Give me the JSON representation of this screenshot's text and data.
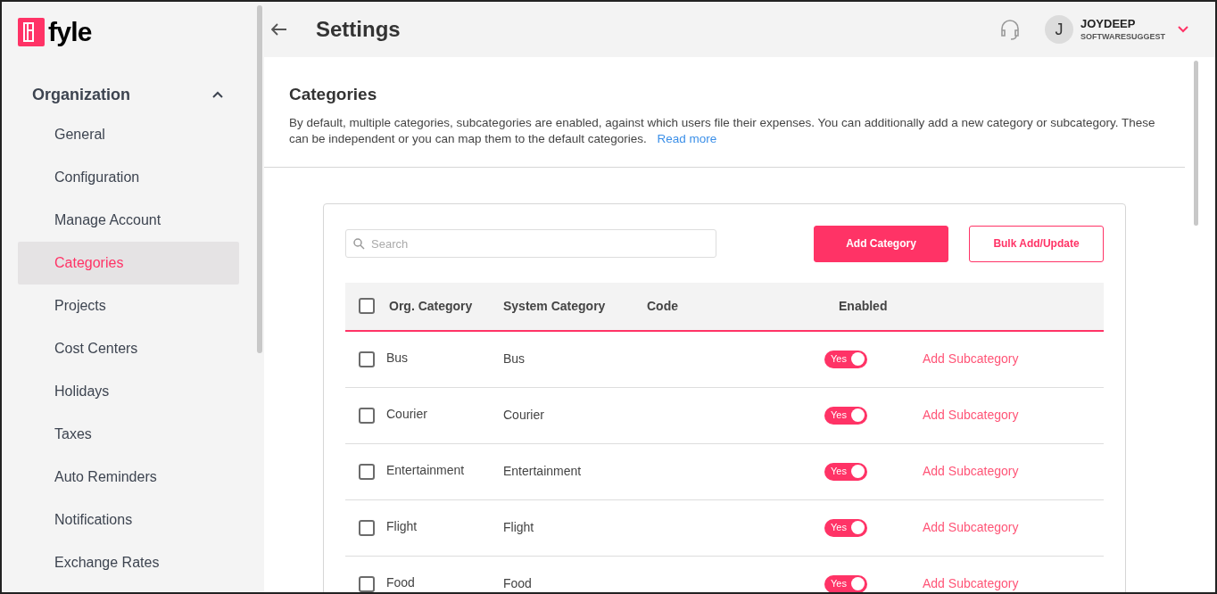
{
  "logo": {
    "text": "fyle"
  },
  "sidebar": {
    "section": {
      "label": "Organization",
      "expanded": true
    },
    "items": [
      {
        "label": "General",
        "selected": false
      },
      {
        "label": "Configuration",
        "selected": false
      },
      {
        "label": "Manage Account",
        "selected": false
      },
      {
        "label": "Categories",
        "selected": true
      },
      {
        "label": "Projects",
        "selected": false
      },
      {
        "label": "Cost Centers",
        "selected": false
      },
      {
        "label": "Holidays",
        "selected": false
      },
      {
        "label": "Taxes",
        "selected": false
      },
      {
        "label": "Auto Reminders",
        "selected": false
      },
      {
        "label": "Notifications",
        "selected": false
      },
      {
        "label": "Exchange Rates",
        "selected": false
      }
    ]
  },
  "header": {
    "title": "Settings",
    "user": {
      "initial": "J",
      "name": "JOYDEEP",
      "org": "SOFTWARESUGGEST"
    }
  },
  "section": {
    "title": "Categories",
    "description": "By default, multiple categories, subcategories are enabled, against which users file their expenses. You can additionally add a new category or subcategory. These can be independent or you can map them to the default categories.",
    "link": "Read more"
  },
  "toolbar": {
    "search": {
      "placeholder": "Search"
    },
    "buttons": [
      {
        "label": "Add Category",
        "kind": "primary"
      },
      {
        "label": "Bulk Add/Update",
        "kind": "outline"
      }
    ]
  },
  "table": {
    "select_all_checked": false,
    "columns": [
      "Org. Category",
      "System Category",
      "Code",
      "Enabled"
    ],
    "rows": [
      {
        "org_category": "Bus",
        "system_category": "Bus",
        "checked": false,
        "enabled": true,
        "toggle_label": "Yes",
        "action": "Add Subcategory"
      },
      {
        "org_category": "Courier",
        "system_category": "Courier",
        "checked": false,
        "enabled": true,
        "toggle_label": "Yes",
        "action": "Add Subcategory"
      },
      {
        "org_category": "Entertainment",
        "system_category": "Entertainment",
        "checked": false,
        "enabled": true,
        "toggle_label": "Yes",
        "action": "Add Subcategory"
      },
      {
        "org_category": "Flight",
        "system_category": "Flight",
        "checked": false,
        "enabled": true,
        "toggle_label": "Yes",
        "action": "Add Subcategory"
      },
      {
        "org_category": "Food",
        "system_category": "Food",
        "checked": false,
        "enabled": true,
        "toggle_label": "Yes",
        "action": "Add Subcategory"
      }
    ]
  }
}
